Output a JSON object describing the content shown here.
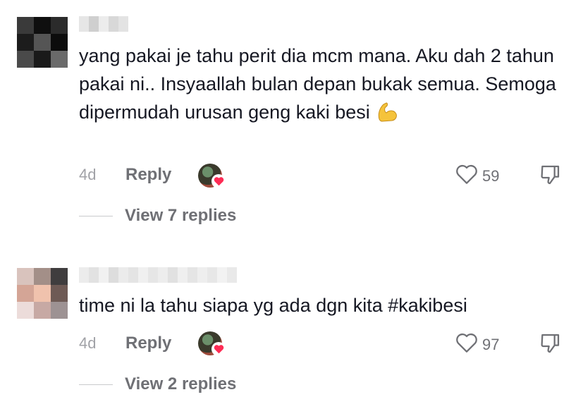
{
  "comments": [
    {
      "text": "yang pakai je tahu perit dia mcm mana. Aku dah 2 tahun pakai ni.. Insyaallah bulan depan bukak semua. Semoga dipermudah urusan geng kaki besi",
      "time": "4d",
      "reply_label": "Reply",
      "likes": "59",
      "view_replies": "View 7 replies"
    },
    {
      "text": "time ni la tahu siapa yg ada dgn kita #kakibesi",
      "time": "4d",
      "reply_label": "Reply",
      "likes": "97",
      "view_replies": "View 2 replies"
    }
  ],
  "icons": {
    "like": "heart-outline-icon",
    "dislike": "thumbs-down-outline-icon",
    "creator_like": "heart-filled-icon",
    "emoji": "flexed-biceps-emoji"
  },
  "colors": {
    "text": "#161823",
    "secondary": "#6f7075",
    "muted": "#a1a2a7",
    "heart": "#fe2c55",
    "emoji": "#f5c33b"
  }
}
